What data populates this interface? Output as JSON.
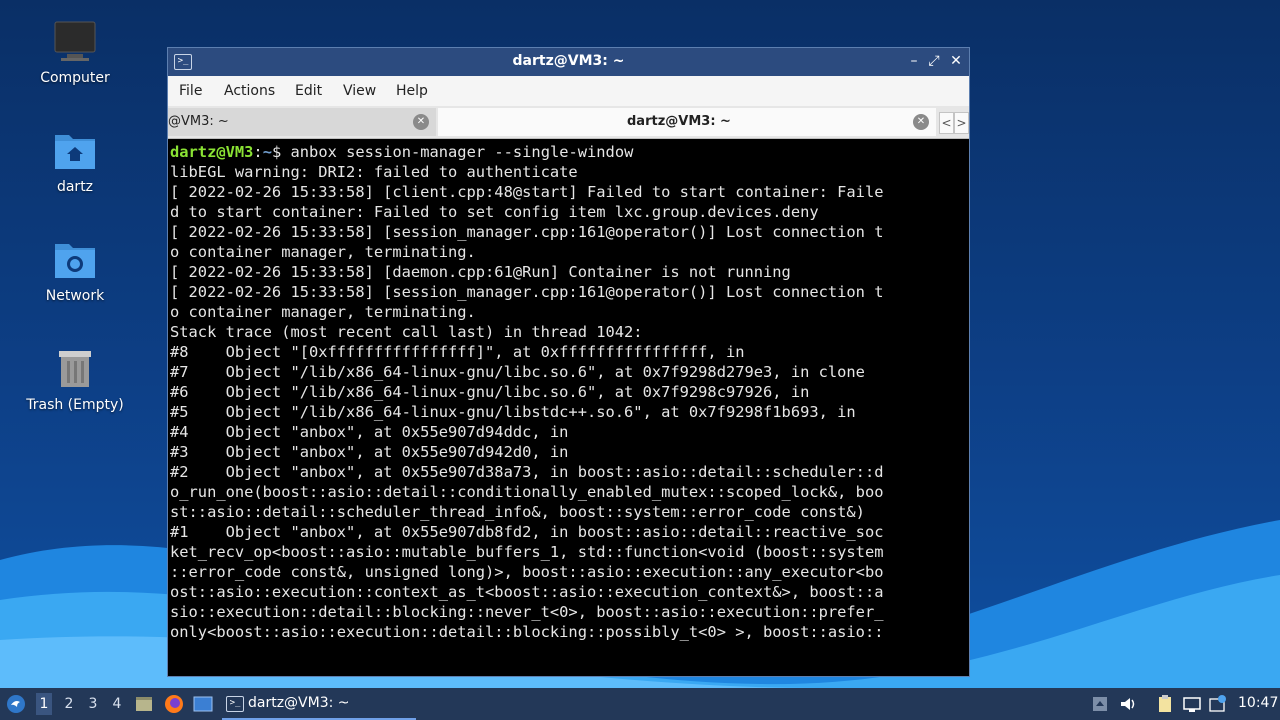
{
  "desktop": {
    "icons": [
      {
        "label": "Computer"
      },
      {
        "label": "dartz"
      },
      {
        "label": "Network"
      },
      {
        "label": "Trash (Empty)"
      }
    ]
  },
  "window": {
    "title": "dartz@VM3: ~",
    "minimize_glyph": "–",
    "maximize_glyph": "⤢",
    "close_glyph": "✕",
    "menu": [
      "File",
      "Actions",
      "Edit",
      "View",
      "Help"
    ],
    "tabs": [
      {
        "label": "@VM3: ~"
      },
      {
        "label": "dartz@VM3: ~"
      }
    ],
    "tab_prev": "<",
    "tab_next": ">"
  },
  "terminal": {
    "prompt_user": "dartz@VM3",
    "prompt_sep": ":",
    "prompt_path": "~",
    "prompt_end": "$ ",
    "command": "anbox session-manager --single-window",
    "lines": [
      "libEGL warning: DRI2: failed to authenticate",
      "[ 2022-02-26 15:33:58] [client.cpp:48@start] Failed to start container: Faile",
      "d to start container: Failed to set config item lxc.group.devices.deny",
      "[ 2022-02-26 15:33:58] [session_manager.cpp:161@operator()] Lost connection t",
      "o container manager, terminating.",
      "[ 2022-02-26 15:33:58] [daemon.cpp:61@Run] Container is not running",
      "[ 2022-02-26 15:33:58] [session_manager.cpp:161@operator()] Lost connection t",
      "o container manager, terminating.",
      "Stack trace (most recent call last) in thread 1042:",
      "#8    Object \"[0xffffffffffffffff]\", at 0xffffffffffffffff, in",
      "#7    Object \"/lib/x86_64-linux-gnu/libc.so.6\", at 0x7f9298d279e3, in clone",
      "#6    Object \"/lib/x86_64-linux-gnu/libc.so.6\", at 0x7f9298c97926, in",
      "#5    Object \"/lib/x86_64-linux-gnu/libstdc++.so.6\", at 0x7f9298f1b693, in",
      "#4    Object \"anbox\", at 0x55e907d94ddc, in",
      "#3    Object \"anbox\", at 0x55e907d942d0, in",
      "#2    Object \"anbox\", at 0x55e907d38a73, in boost::asio::detail::scheduler::d",
      "o_run_one(boost::asio::detail::conditionally_enabled_mutex::scoped_lock&, boo",
      "st::asio::detail::scheduler_thread_info&, boost::system::error_code const&)",
      "#1    Object \"anbox\", at 0x55e907db8fd2, in boost::asio::detail::reactive_soc",
      "ket_recv_op<boost::asio::mutable_buffers_1, std::function<void (boost::system",
      "::error_code const&, unsigned long)>, boost::asio::execution::any_executor<bo",
      "ost::asio::execution::context_as_t<boost::asio::execution_context&>, boost::a",
      "sio::execution::detail::blocking::never_t<0>, boost::asio::execution::prefer_",
      "only<boost::asio::execution::detail::blocking::possibly_t<0> >, boost::asio::"
    ]
  },
  "taskbar": {
    "workspaces": [
      "1",
      "2",
      "3",
      "4"
    ],
    "active_workspace": "1",
    "task_label": "dartz@VM3: ~",
    "clock": "10:47"
  },
  "colors": {
    "titlebar": "#2c4b7f",
    "prompt_user": "#8ae234",
    "prompt_path": "#729fcf",
    "taskbar": "#233858"
  }
}
